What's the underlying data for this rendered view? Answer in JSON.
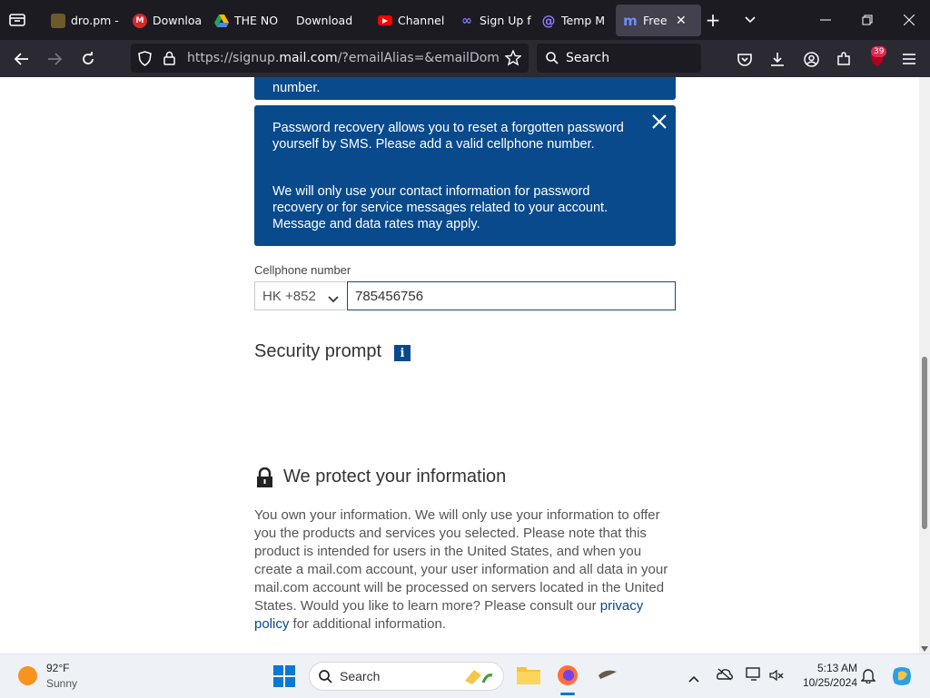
{
  "browser": {
    "tabs": [
      {
        "label": "dro.pm -",
        "favicon": "dro-icon",
        "color": "#6b5a2a"
      },
      {
        "label": "Downloa",
        "favicon": "mega-icon",
        "color": "#d9272e"
      },
      {
        "label": "THE NO",
        "favicon": "google-drive-icon",
        "color": "#1fa463"
      },
      {
        "label": "Download",
        "favicon": "blank-icon",
        "color": "#1c1b22"
      },
      {
        "label": "Channel",
        "favicon": "youtube-icon",
        "color": "#ff0000"
      },
      {
        "label": "Sign Up f",
        "favicon": "meta-icon",
        "color": "#7a7bff"
      },
      {
        "label": "Temp M",
        "favicon": "tempmail-icon",
        "color": "#6a5cff"
      },
      {
        "label": "Free V",
        "favicon": "mailcom-icon",
        "color": "#3b5bdb",
        "active": true
      }
    ],
    "url_prefix": "https://signup.",
    "url_domain": "mail.com",
    "url_rest": "/?emailAlias=&emailDomain=m",
    "search_placeholder": "Search",
    "extension_badge": "39"
  },
  "page": {
    "info_top_text": "number.",
    "info_box": {
      "para1": "Password recovery allows you to reset a forgotten password yourself by SMS. Please add a valid cellphone number.",
      "para2": "We will only use your contact information for password recovery or for service messages related to your account. Message and data rates may apply."
    },
    "cellphone_label": "Cellphone number",
    "country_code": "HK +852",
    "phone_value": "785456756",
    "security_prompt_title": "Security prompt",
    "info_icon_glyph": "i",
    "protect_title": "We protect your information",
    "protect_text_before": "You own your information. We will only use your information to offer you the products and services you selected. Please note that this product is intended for users in the United States, and when you create a mail.com account, your user information and all data in your mail.com account will be processed on servers located in the United States. Would you like to learn more? Please consult our ",
    "protect_link": "privacy policy",
    "protect_text_after": " for additional information."
  },
  "taskbar": {
    "weather_temp": "92°F",
    "weather_desc": "Sunny",
    "search_placeholder": "Search",
    "time": "5:13 AM",
    "date": "10/25/2024"
  },
  "colors": {
    "brand_blue": "#084a8c",
    "chrome_dark": "#1c1b22",
    "toolbar": "#2b2a33"
  }
}
